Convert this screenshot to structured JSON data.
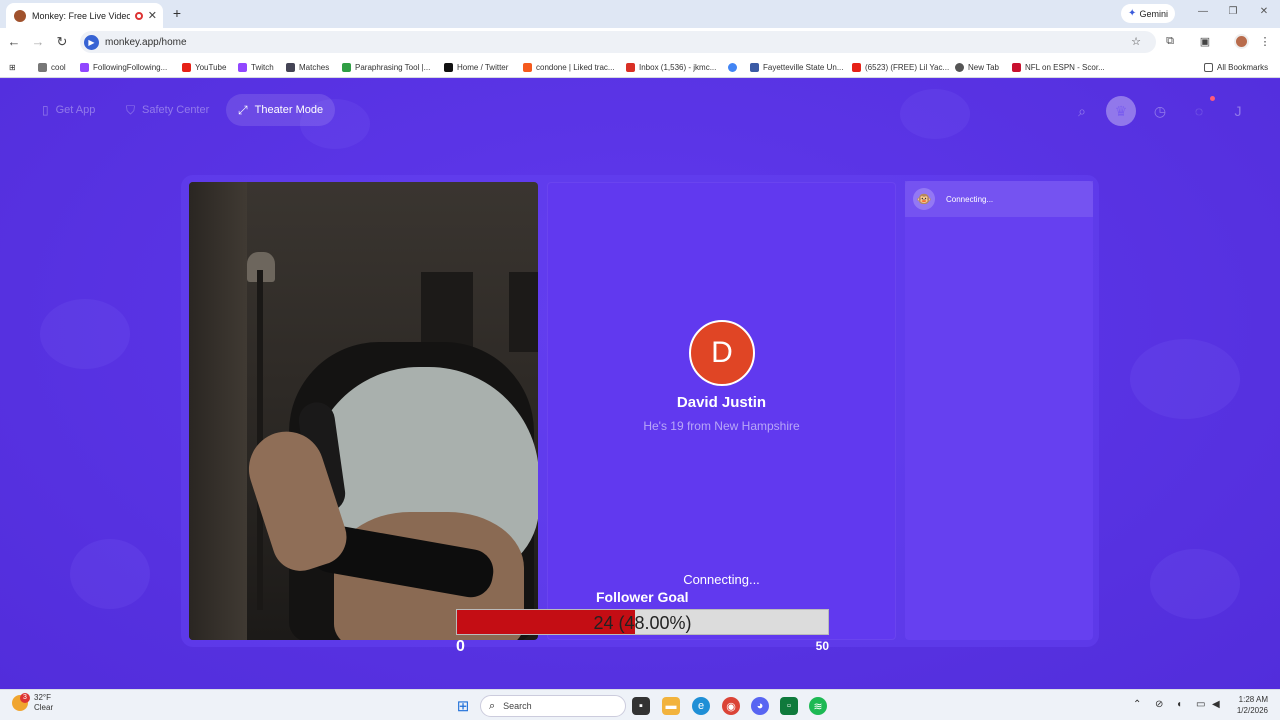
{
  "browser": {
    "tab_title": "Monkey: Free Live Video Ch",
    "new_tab_symbol": "+",
    "gemini_label": "Gemini",
    "url": "monkey.app/home",
    "bookmarks": [
      "cool",
      "FollowingFollowing...",
      "YouTube",
      "Twitch",
      "Matches",
      "Paraphrasing Tool |...",
      "Home / Twitter",
      "condone | Liked trac...",
      "Inbox (1,536) - jkmc...",
      "",
      "Fayetteville State Un...",
      "(6523) (FREE) Lil Yac...",
      "New Tab",
      "NFL on ESPN - Scor..."
    ],
    "all_bookmarks": "All Bookmarks"
  },
  "nav": {
    "get_app": "Get App",
    "safety_center": "Safety Center",
    "theater_mode": "Theater Mode",
    "profile_initial": "J"
  },
  "partner": {
    "initial": "D",
    "name": "David Justin",
    "description": "He's 19 from New Hampshire",
    "status": "Connecting..."
  },
  "chat": {
    "status": "Connecting..."
  },
  "follower_goal": {
    "title": "Follower Goal",
    "current": 24,
    "goal": 50,
    "label": "24 (48.00%)",
    "progress_fraction": 0.48,
    "min_label": "0",
    "max_label": "50"
  },
  "taskbar": {
    "weather_temp": "32°F",
    "weather_cond": "Clear",
    "weather_badge": "3",
    "search_placeholder": "Search",
    "time": "1:28 AM",
    "date": "1/2/2026"
  },
  "colors": {
    "page_bg": "#5b34e6",
    "avatar_bg": "#e04525",
    "goal_fill": "#c40d14"
  }
}
